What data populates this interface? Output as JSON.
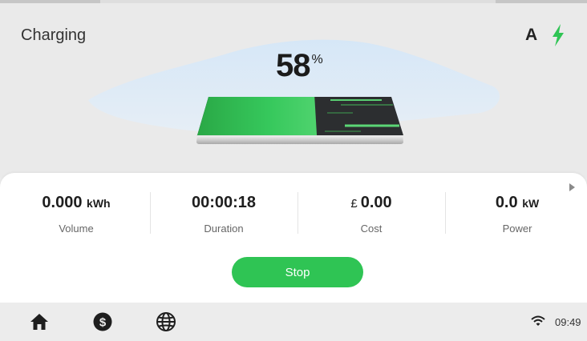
{
  "header": {
    "status": "Charging",
    "connector": "A",
    "bolt_icon": "lightning-bolt-icon",
    "bolt_color": "#2fc454"
  },
  "battery": {
    "percent": "58",
    "percent_symbol": "%",
    "level": 0.58
  },
  "stats": [
    {
      "value": "0.000",
      "unit": "kWh",
      "label": "Volume"
    },
    {
      "value": "00:00:18",
      "unit": "",
      "label": "Duration"
    },
    {
      "value": "0.00",
      "currency": "£",
      "label": "Cost"
    },
    {
      "value": "0.0",
      "unit": "kW",
      "label": "Power"
    }
  ],
  "actions": {
    "stop_label": "Stop",
    "stop_color": "#2fc454"
  },
  "bottom_bar": {
    "icons": [
      "home-icon",
      "dollar-icon",
      "globe-icon"
    ],
    "time": "09:49",
    "wifi_icon": "wifi-icon"
  }
}
